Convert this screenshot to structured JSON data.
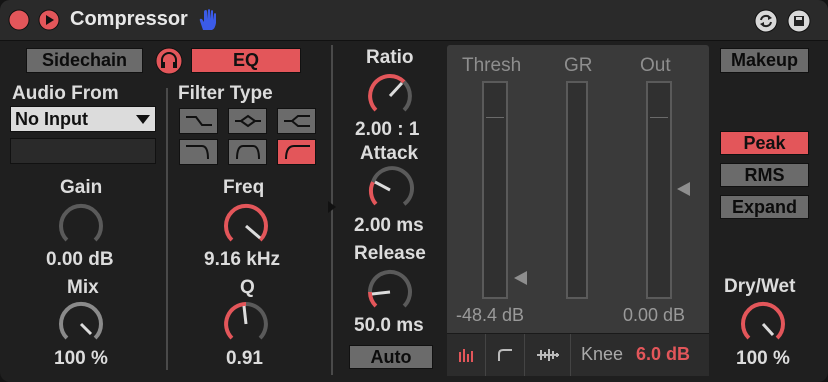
{
  "title": "Compressor",
  "colors": {
    "accent": "#e3565a",
    "bg": "#1f1f1f",
    "panel": "#3a3a3a",
    "inactive": "#6b6b6b",
    "text": "#dcdcdc"
  },
  "sidechain": {
    "sidechain_label": "Sidechain",
    "eq_label": "EQ",
    "audio_from_label": "Audio From",
    "audio_from_value": "No Input",
    "gain_label": "Gain",
    "gain_value": "0.00 dB",
    "mix_label": "Mix",
    "mix_value": "100 %"
  },
  "eq": {
    "filter_type_label": "Filter Type",
    "filter_types": [
      "bandpass-low",
      "notch",
      "bandpass-high",
      "lowpass",
      "bell",
      "highpass"
    ],
    "selected_filter": 5,
    "freq_label": "Freq",
    "freq_value": "9.16 kHz",
    "q_label": "Q",
    "q_value": "0.91"
  },
  "dynamics": {
    "ratio_label": "Ratio",
    "ratio_value": "2.00 : 1",
    "attack_label": "Attack",
    "attack_value": "2.00 ms",
    "release_label": "Release",
    "release_value": "50.0 ms",
    "auto_label": "Auto"
  },
  "meters": {
    "thresh_label": "Thresh",
    "gr_label": "GR",
    "out_label": "Out",
    "thresh_value": "-48.4 dB",
    "out_value": "0.00 dB",
    "knee_label": "Knee",
    "knee_value": "6.0 dB",
    "view_icons": [
      "bars-icon",
      "curve-icon",
      "activity-icon"
    ]
  },
  "output": {
    "makeup_label": "Makeup",
    "peak_label": "Peak",
    "rms_label": "RMS",
    "expand_label": "Expand",
    "drywet_label": "Dry/Wet",
    "drywet_value": "100 %"
  }
}
